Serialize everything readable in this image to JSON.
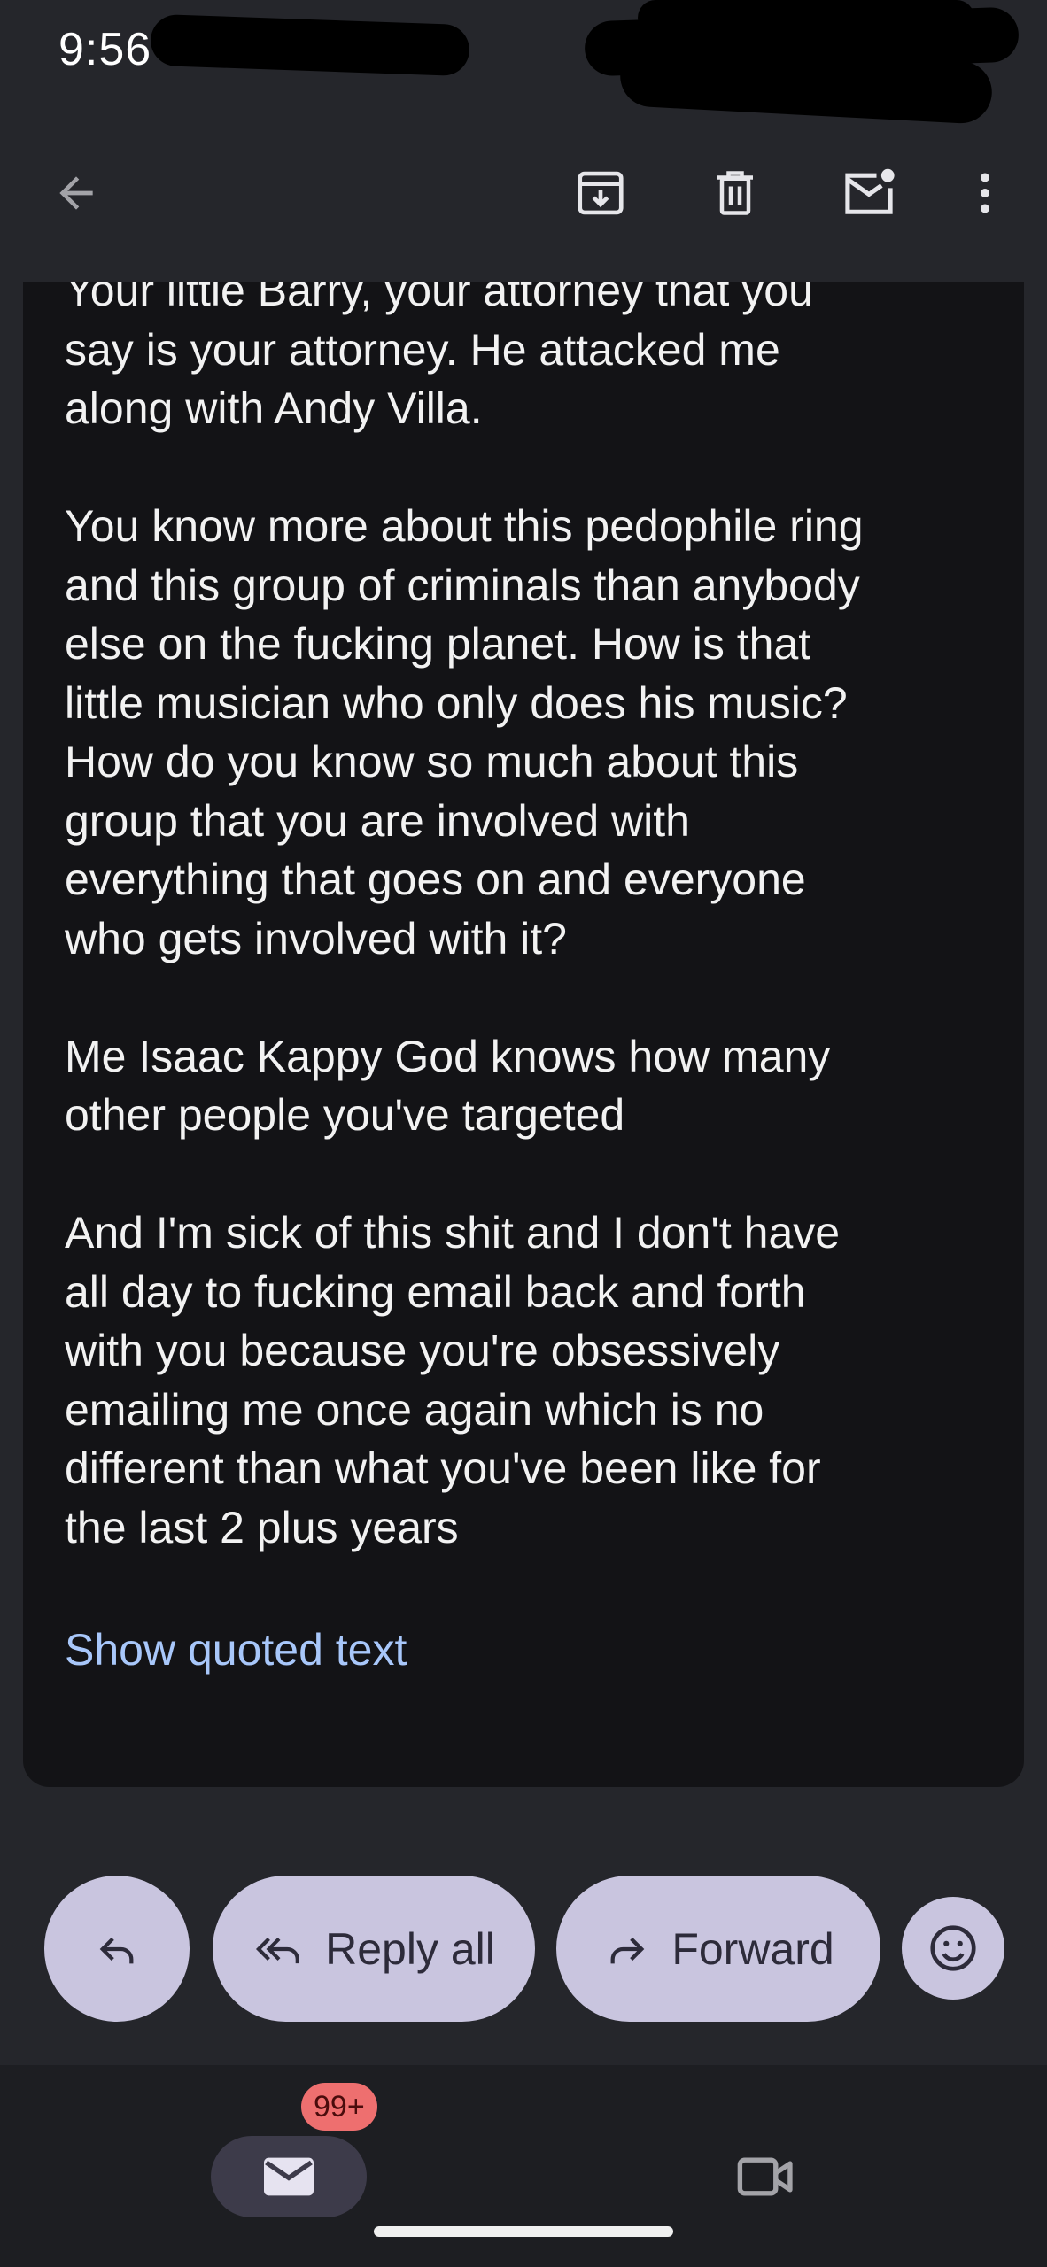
{
  "status_bar": {
    "time": "9:56"
  },
  "toolbar": {
    "back_icon": "arrow-back-icon",
    "archive_icon": "archive-icon",
    "delete_icon": "trash-icon",
    "unread_icon": "mark-unread-icon",
    "more_icon": "more-vert-icon"
  },
  "email": {
    "paragraphs": [
      "Your little Barry, your attorney that you\nsay is your attorney. He attacked me\nalong with Andy Villa.",
      "You know more about this pedophile ring\nand this group of criminals than anybody\nelse on the fucking planet. How is that\nlittle musician who only does his music?\nHow do you know so much about this\ngroup that you are involved with\neverything that goes on and everyone\nwho gets involved with it?",
      "Me Isaac Kappy God knows how many\nother people you've targeted",
      "And I'm sick of this shit and I don't have\nall day to fucking email back and forth\nwith you because you're obsessively\nemailing me once again which is no\ndifferent than what you've been like for\nthe last 2 plus years"
    ],
    "show_quoted_label": "Show quoted text"
  },
  "actions": {
    "reply_all_label": "Reply all",
    "forward_label": "Forward"
  },
  "bottom_nav": {
    "mail_badge": "99+"
  },
  "colors": {
    "background": "#25262b",
    "card": "#131316",
    "link": "#a8c7fa",
    "pill": "#c9c5df",
    "badge": "#ee6f6f"
  }
}
